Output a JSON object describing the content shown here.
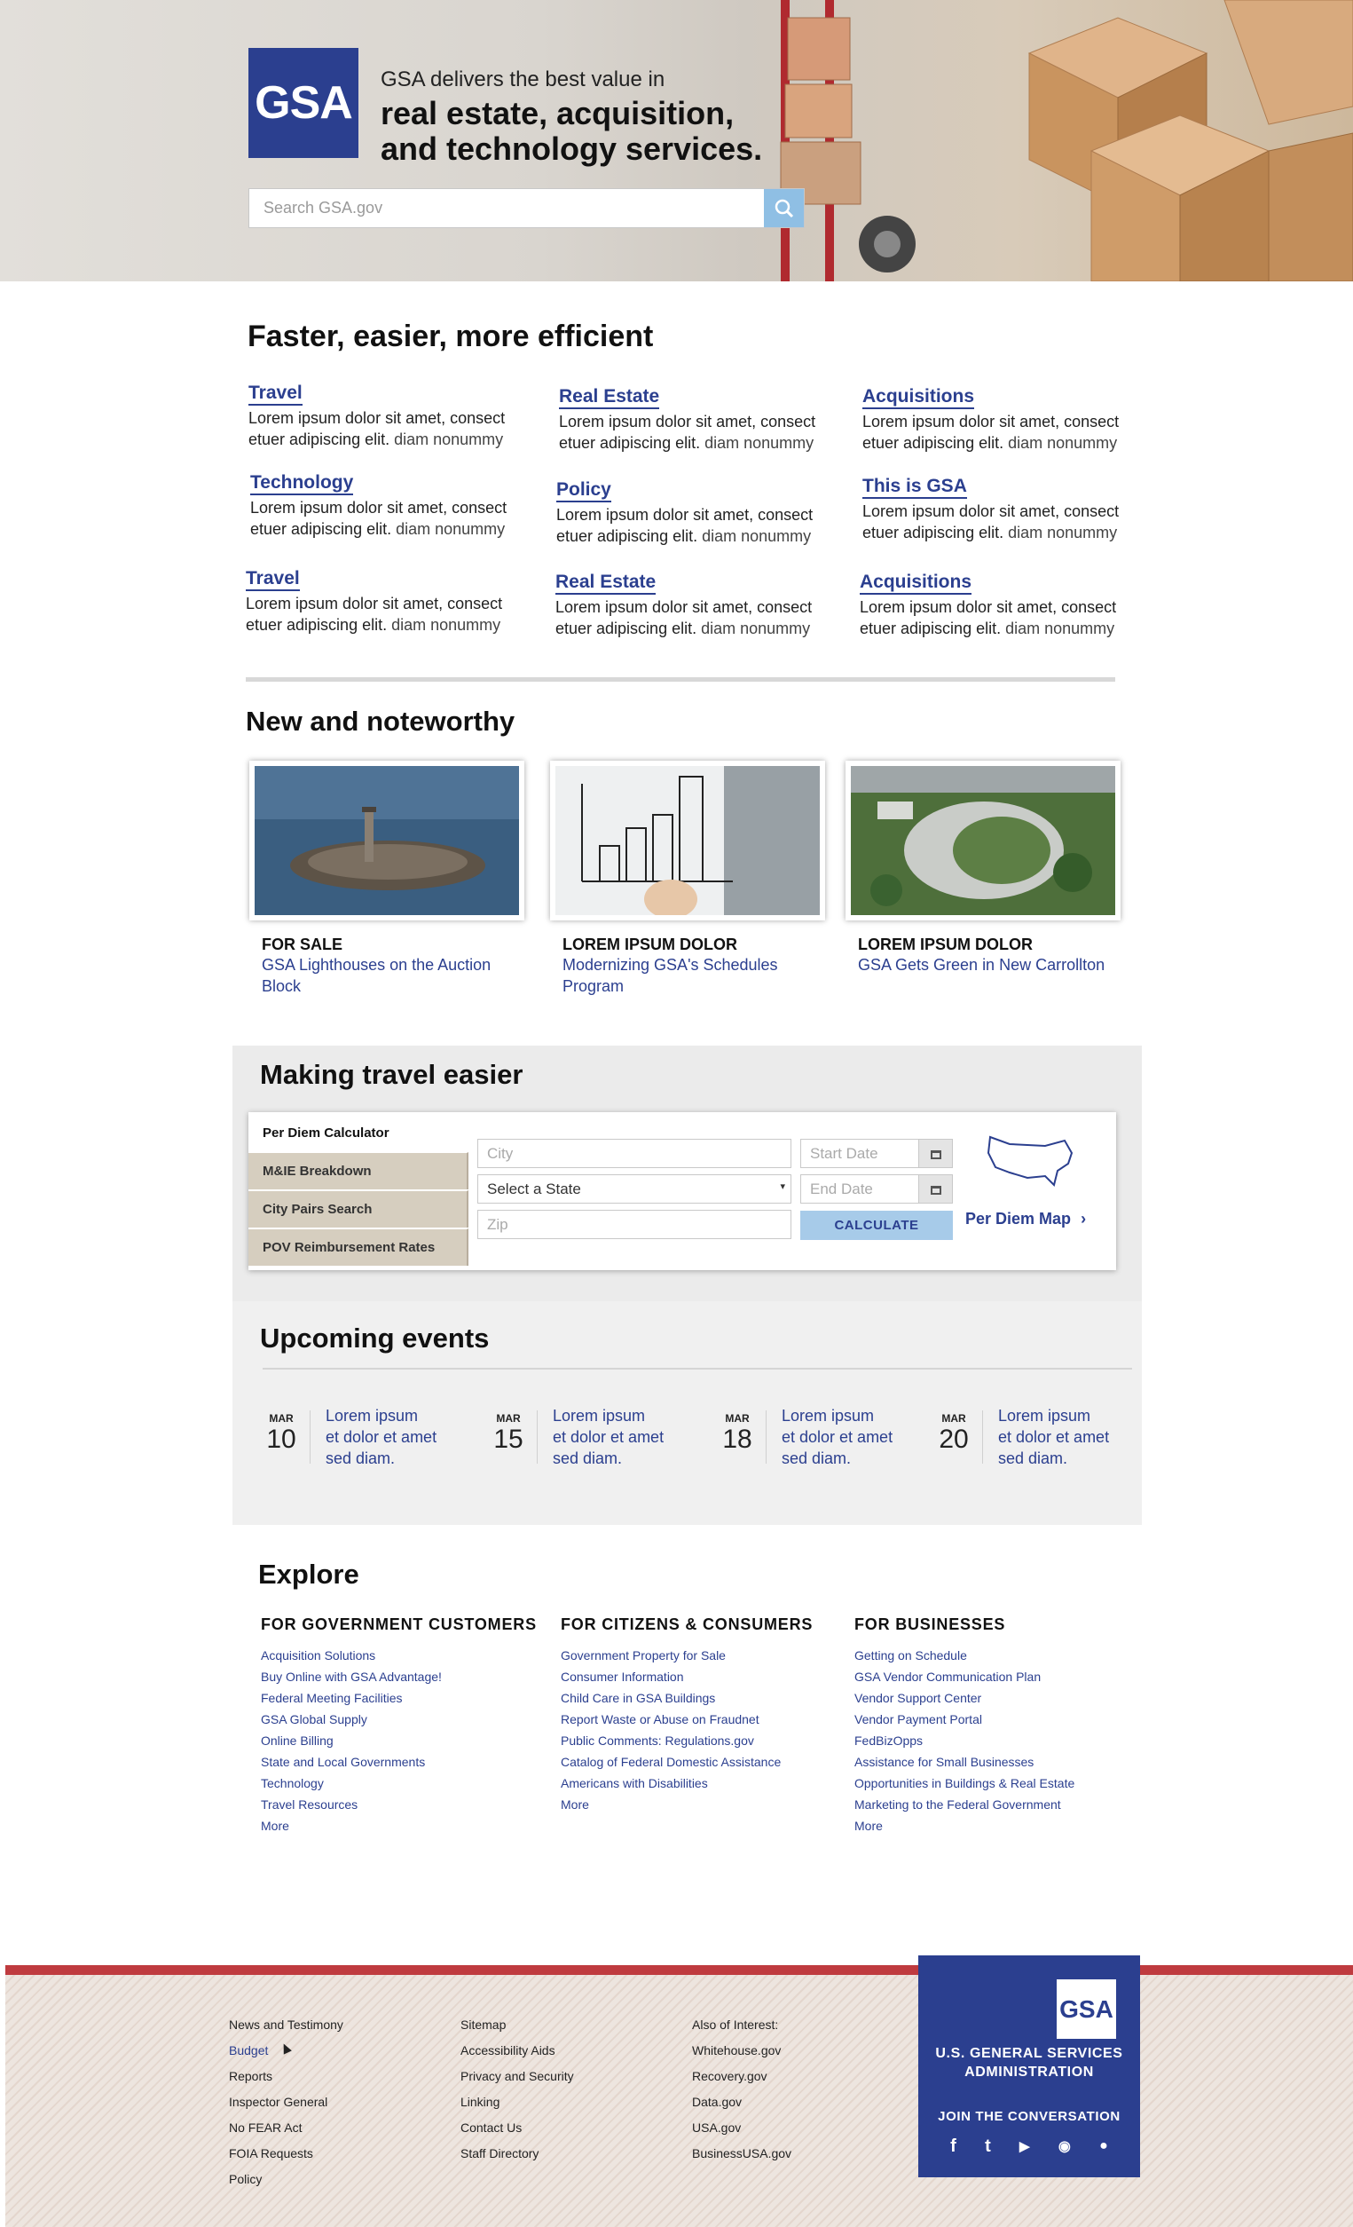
{
  "hero": {
    "logo_text": "GSA",
    "tagline_line1": "GSA delivers the best value in",
    "tagline_line2": "real estate, acquisition,",
    "tagline_line3": "and technology services.",
    "search_placeholder": "Search GSA.gov"
  },
  "faster": {
    "title": "Faster, easier, more efficient",
    "items": [
      {
        "title": "Travel",
        "line1": "Lorem ipsum dolor sit amet, consect",
        "line2a": "etuer adipiscing elit.",
        "line2b": " diam nonummy"
      },
      {
        "title": "Real Estate",
        "line1": "Lorem ipsum dolor sit amet, consect",
        "line2a": "etuer adipiscing elit.",
        "line2b": " diam nonummy"
      },
      {
        "title": "Acquisitions",
        "line1": "Lorem ipsum dolor sit amet, consect",
        "line2a": "etuer adipiscing elit.",
        "line2b": " diam nonummy"
      },
      {
        "title": "Technology",
        "line1": "Lorem ipsum dolor sit amet, consect",
        "line2a": "etuer adipiscing elit.",
        "line2b": " diam nonummy"
      },
      {
        "title": "Policy",
        "line1": "Lorem ipsum dolor sit amet, consect",
        "line2a": "etuer adipiscing elit.",
        "line2b": " diam nonummy"
      },
      {
        "title": "This is GSA",
        "line1": "Lorem ipsum dolor sit amet, consect",
        "line2a": "etuer adipiscing elit.",
        "line2b": " diam nonummy"
      },
      {
        "title": "Travel",
        "line1": "Lorem ipsum dolor sit amet, consect",
        "line2a": "etuer adipiscing elit.",
        "line2b": " diam nonummy"
      },
      {
        "title": "Real Estate",
        "line1": "Lorem ipsum dolor sit amet, consect",
        "line2a": "etuer adipiscing elit.",
        "line2b": " diam nonummy"
      },
      {
        "title": "Acquisitions",
        "line1": "Lorem ipsum dolor sit amet, consect",
        "line2a": "etuer adipiscing elit.",
        "line2b": " diam nonummy"
      }
    ]
  },
  "noteworthy": {
    "title": "New and noteworthy",
    "cards": [
      {
        "kicker": "FOR SALE",
        "line1": "GSA Lighthouses on the Auction",
        "line2": "Block"
      },
      {
        "kicker": "LOREM IPSUM DOLOR",
        "line1": "Modernizing GSA's Schedules",
        "line2": "Program"
      },
      {
        "kicker": "LOREM IPSUM DOLOR",
        "line1": "GSA Gets Green in New Carrollton",
        "line2": ""
      }
    ]
  },
  "travel": {
    "title": "Making travel easier",
    "tabs": [
      "Per Diem Calculator",
      "M&IE Breakdown",
      "City Pairs Search",
      "POV Reimbursement Rates"
    ],
    "city_placeholder": "City",
    "state_value": "Select a State",
    "zip_placeholder": "Zip",
    "start_placeholder": "Start Date",
    "end_placeholder": "End Date",
    "calculate_label": "CALCULATE",
    "map_label": "Per Diem Map"
  },
  "events": {
    "title": "Upcoming events",
    "items": [
      {
        "month": "MAR",
        "day": "10",
        "l1": "Lorem ipsum",
        "l2": "et dolor et amet",
        "l3": "sed diam."
      },
      {
        "month": "MAR",
        "day": "15",
        "l1": "Lorem ipsum",
        "l2": "et dolor et amet",
        "l3": "sed diam."
      },
      {
        "month": "MAR",
        "day": "18",
        "l1": "Lorem ipsum",
        "l2": "et dolor et amet",
        "l3": "sed diam."
      },
      {
        "month": "MAR",
        "day": "20",
        "l1": "Lorem ipsum",
        "l2": "et dolor et amet",
        "l3": "sed diam."
      }
    ]
  },
  "explore": {
    "title": "Explore",
    "columns": [
      {
        "heading": "FOR GOVERNMENT CUSTOMERS",
        "links": [
          "Acquisition Solutions",
          "Buy Online with GSA Advantage!",
          "Federal Meeting Facilities",
          "GSA Global Supply",
          "Online Billing",
          "State and Local Governments",
          "Technology",
          "Travel Resources",
          "More"
        ]
      },
      {
        "heading": "FOR CITIZENS & CONSUMERS",
        "links": [
          "Government Property for Sale",
          "Consumer Information",
          "Child Care in GSA Buildings",
          "Report Waste or Abuse on Fraudnet",
          "Public Comments: Regulations.gov",
          "Catalog of Federal Domestic Assistance",
          "Americans with Disabilities",
          "More"
        ]
      },
      {
        "heading": "FOR BUSINESSES",
        "links": [
          "Getting on Schedule",
          "GSA Vendor Communication Plan",
          "Vendor Support Center",
          "Vendor Payment Portal",
          "FedBizOpps",
          "Assistance for Small Businesses",
          "Opportunities in Buildings & Real Estate",
          "Marketing to the Federal Government",
          "More"
        ]
      }
    ]
  },
  "footer": {
    "col1": [
      "News and Testimony",
      "Budget",
      "Reports",
      "Inspector General",
      "No FEAR Act",
      "FOIA Requests",
      "Policy"
    ],
    "col2": [
      "Sitemap",
      "Accessibility Aids",
      "Privacy and Security",
      "Linking",
      "Contact Us",
      "Staff Directory"
    ],
    "col3_heading": "Also of Interest:",
    "col3": [
      "Whitehouse.gov",
      "Recovery.gov",
      "Data.gov",
      "USA.gov",
      "BusinessUSA.gov"
    ],
    "logo_text": "GSA",
    "agency_line1": "U.S. GENERAL SERVICES",
    "agency_line2": "ADMINISTRATION",
    "join_label": "JOIN THE CONVERSATION",
    "social_glyphs": {
      "facebook": "f",
      "twitter": "t",
      "youtube": "▶",
      "rss": "◉",
      "flickr": "●"
    }
  }
}
